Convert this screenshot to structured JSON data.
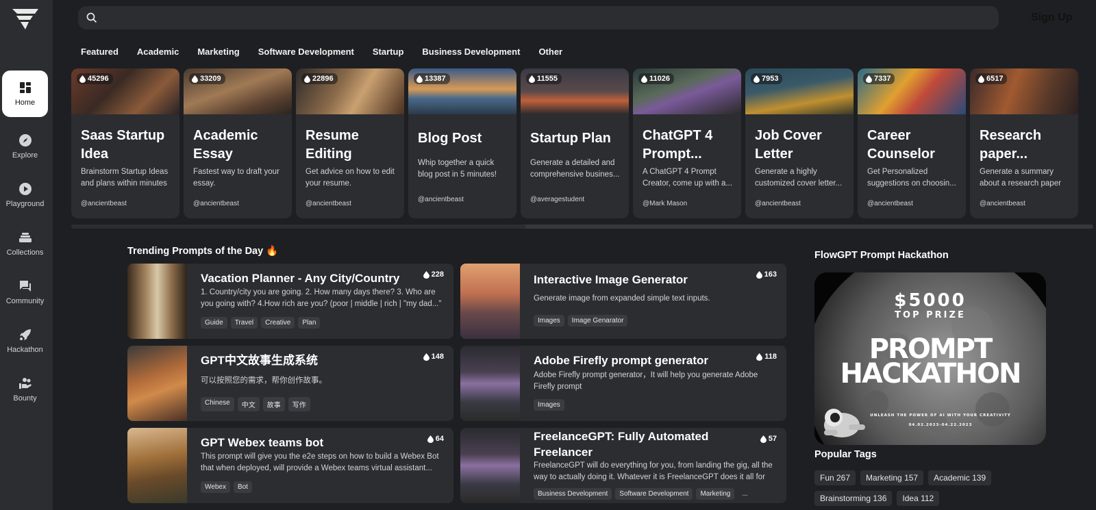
{
  "search": {
    "placeholder": ""
  },
  "header": {
    "signup_label": "Sign Up"
  },
  "sidebar": {
    "items": [
      {
        "label": "Home",
        "icon": "home-icon",
        "active": true
      },
      {
        "label": "Explore",
        "icon": "compass-icon"
      },
      {
        "label": "Playground",
        "icon": "play-icon"
      },
      {
        "label": "Collections",
        "icon": "stack-icon"
      },
      {
        "label": "Community",
        "icon": "chat-icon"
      },
      {
        "label": "Hackathon",
        "icon": "rocket-icon"
      },
      {
        "label": "Bounty",
        "icon": "hand-coins-icon"
      }
    ]
  },
  "tabs": [
    "Featured",
    "Academic",
    "Marketing",
    "Software Development",
    "Startup",
    "Business Development",
    "Other"
  ],
  "featured": [
    {
      "likes": "45296",
      "title": "Saas Startup Idea",
      "desc": "Brainstorm Startup Ideas and plans within minutes",
      "author": "@ancientbeast"
    },
    {
      "likes": "33209",
      "title": "Academic Essay",
      "desc": "Fastest way to draft your essay.",
      "author": "@ancientbeast"
    },
    {
      "likes": "22896",
      "title": "Resume Editing",
      "desc": "Get advice on how to edit your resume.",
      "author": "@ancientbeast"
    },
    {
      "likes": "13387",
      "title": "Blog Post",
      "desc": "Whip together a quick blog post in 5 minutes!",
      "author": "@ancientbeast"
    },
    {
      "likes": "11555",
      "title": "Startup Plan",
      "desc": "Generate a detailed and comprehensive busines...",
      "author": "@averagestudent"
    },
    {
      "likes": "11026",
      "title": "ChatGPT 4 Prompt...",
      "desc": "A ChatGPT 4 Prompt Creator, come up with a...",
      "author": "@Mark Mason"
    },
    {
      "likes": "7953",
      "title": "Job Cover Letter",
      "desc": "Generate a highly customized cover letter...",
      "author": "@ancientbeast"
    },
    {
      "likes": "7337",
      "title": "Career Counselor",
      "desc": "Get Personalized suggestions on choosin...",
      "author": "@ancientbeast"
    },
    {
      "likes": "6517",
      "title": "Research paper...",
      "desc": "Generate a summary about a research paper",
      "author": "@ancientbeast"
    }
  ],
  "trending": {
    "title": "Trending Prompts of the Day 🔥",
    "items": [
      {
        "title": "Vacation Planner - Any City/Country",
        "likes": "228",
        "desc": "1. Country/city you are going. 2. How many days there? 3. Who are you going with? 4.How rich are you? (poor | middle | rich | \"my dad...\" leve...",
        "tags": [
          "Guide",
          "Travel",
          "Creative",
          "Plan"
        ]
      },
      {
        "title": "Interactive Image Generator",
        "likes": "163",
        "desc": "Generate image from expanded simple text inputs.",
        "tags": [
          "Images",
          "Image Genarator"
        ]
      },
      {
        "title": "GPT中文故事生成系统",
        "likes": "148",
        "desc": "可以按照您的需求，帮你创作故事。",
        "tags": [
          "Chinese",
          "中文",
          "故事",
          "写作"
        ]
      },
      {
        "title": "Adobe Firefly prompt generator",
        "likes": "118",
        "desc": "Adobe Firefly prompt generator，It will help you generate Adobe Firefly prompt",
        "tags": [
          "Images"
        ]
      },
      {
        "title": "GPT Webex teams bot",
        "likes": "64",
        "desc": "This prompt will give you the e2e steps on how to build a Webex Bot that when deployed, will provide a Webex teams virtual assistant...",
        "tags": [
          "Webex",
          "Bot"
        ]
      },
      {
        "title": "FreelanceGPT: Fully Automated Freelancer",
        "likes": "57",
        "desc": "FreelanceGPT will do everything for you, from landing the gig, all the way to actually doing it. Whatever it is FreelanceGPT does it all for you...",
        "tags": [
          "Business Development",
          "Software Development",
          "Marketing",
          "..."
        ]
      }
    ]
  },
  "hackathon": {
    "title": "FlowGPT Prompt Hackathon",
    "prize": "$5000",
    "prize_sub": "TOP PRIZE",
    "headline1": "PROMPT",
    "headline2": "HACKATHON",
    "tagline": "UNLEASH THE POWER OF AI WITH YOUR CREATIVITY",
    "dates": "04.02.2023-04.22.2023"
  },
  "popular_tags": {
    "title": "Popular Tags",
    "items": [
      "Fun 267",
      "Marketing 157",
      "Academic 139",
      "Brainstorming 136",
      "Idea 112"
    ]
  },
  "colors": {
    "background": "#1e1f22",
    "surface": "#2b2d31",
    "tag": "#3a3c42"
  }
}
